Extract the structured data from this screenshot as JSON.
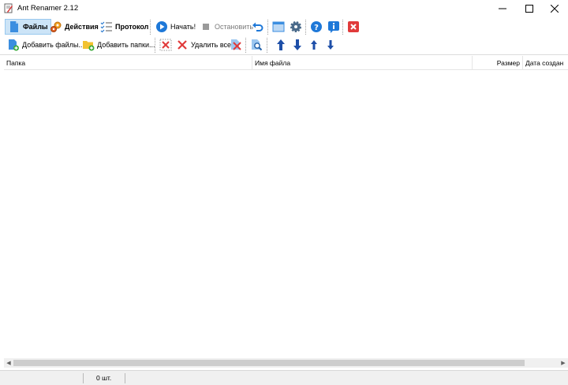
{
  "window": {
    "title": "Ant Renamer 2.12"
  },
  "toolbar1": {
    "files": "Файлы",
    "actions": "Действия",
    "log": "Протокол",
    "start": "Начать!",
    "stop": "Остановить"
  },
  "toolbar2": {
    "add_files": "Добавить файлы...",
    "add_folders": "Добавить папки...",
    "remove_all": "Удалить все"
  },
  "list": {
    "columns": [
      "Папка",
      "Имя файла",
      "Размер",
      "Дата создан"
    ]
  },
  "status": {
    "count": "0 шт."
  },
  "colors": {
    "active_tab_bg": "#cce4f7",
    "blue_icon": "#1e6fd0",
    "close_red": "#e03a3a"
  }
}
